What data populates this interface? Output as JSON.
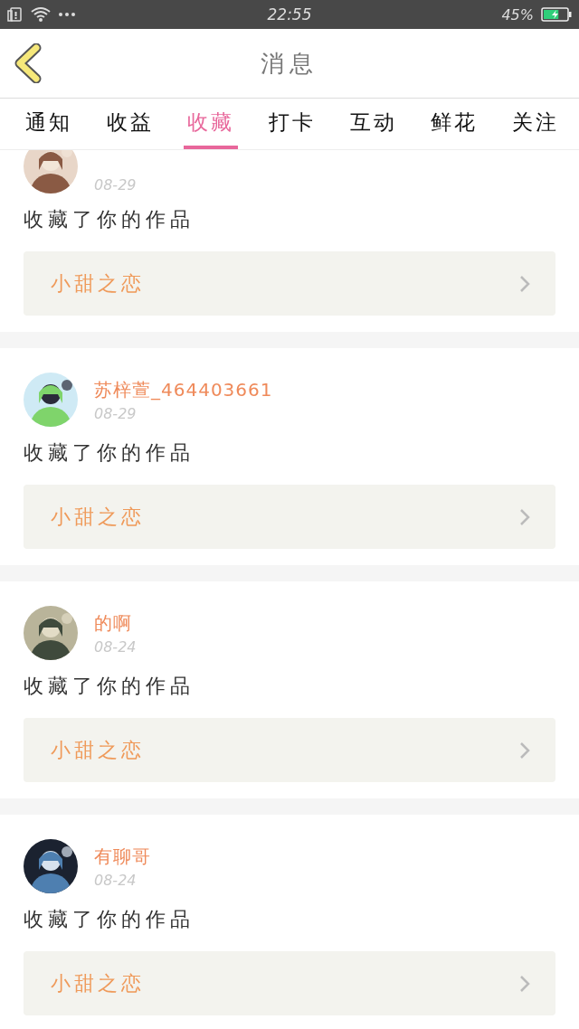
{
  "status_bar": {
    "time": "22:55",
    "battery": "45%"
  },
  "header": {
    "title": "消息"
  },
  "tabs": [
    {
      "label": "通知",
      "selected": false
    },
    {
      "label": "收益",
      "selected": false
    },
    {
      "label": "收藏",
      "selected": true
    },
    {
      "label": "打卡",
      "selected": false
    },
    {
      "label": "互动",
      "selected": false
    },
    {
      "label": "鲜花",
      "selected": false
    },
    {
      "label": "关注",
      "selected": false
    }
  ],
  "messages": [
    {
      "date": "08-29",
      "text": "收藏了你的作品",
      "work": "小甜之恋"
    },
    {
      "name": "苏梓萱_464403661",
      "date": "08-29",
      "text": "收藏了你的作品",
      "work": "小甜之恋"
    },
    {
      "name": "的啊",
      "date": "08-24",
      "text": "收藏了你的作品",
      "work": "小甜之恋"
    },
    {
      "name": "有聊哥",
      "date": "08-24",
      "text": "收藏了你的作品",
      "work": "小甜之恋"
    }
  ]
}
